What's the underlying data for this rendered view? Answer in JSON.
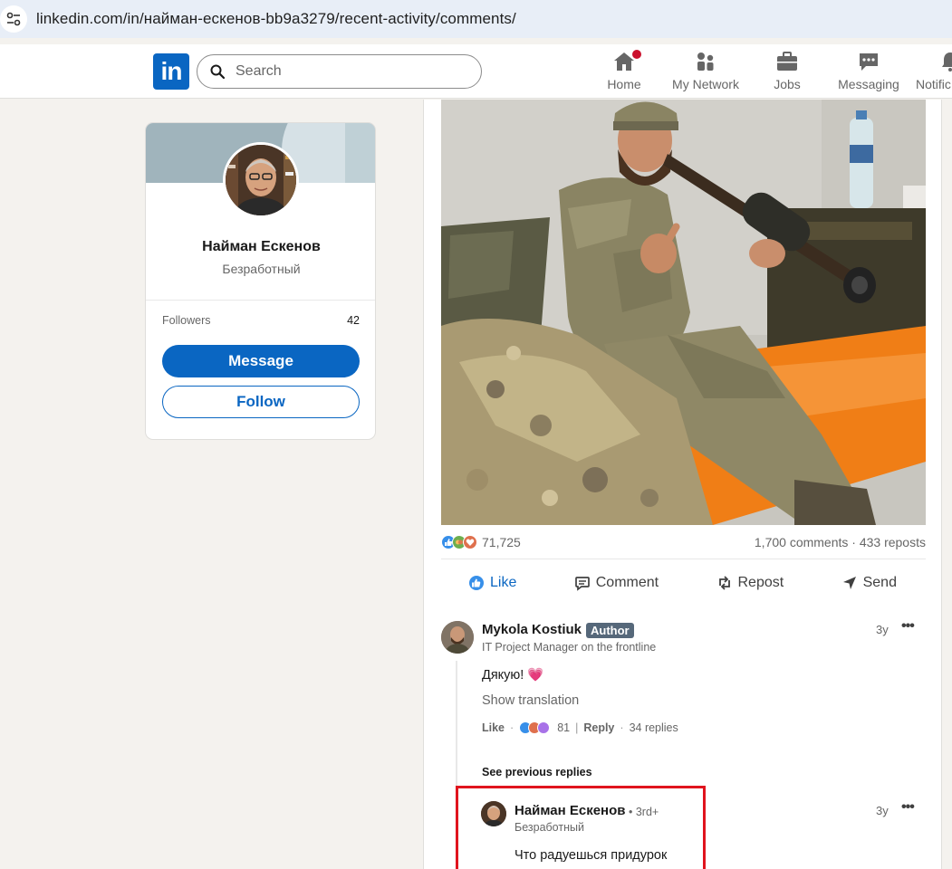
{
  "browser": {
    "url": "linkedin.com/in/найман-ескенов-bb9a3279/recent-activity/comments/"
  },
  "header": {
    "logo": "in",
    "search_placeholder": "Search",
    "nav": [
      {
        "label": "Home",
        "icon": "home-icon"
      },
      {
        "label": "My Network",
        "icon": "network-icon"
      },
      {
        "label": "Jobs",
        "icon": "briefcase-icon"
      },
      {
        "label": "Messaging",
        "icon": "chat-icon"
      },
      {
        "label": "Notific",
        "icon": "bell-icon"
      }
    ]
  },
  "profile": {
    "name": "Найман Ескенов",
    "headline": "Безработный",
    "followers_label": "Followers",
    "followers_count": "42",
    "message_label": "Message",
    "follow_label": "Follow"
  },
  "post": {
    "reactions_count": "71,725",
    "comments_reposts": "1,700 comments · 433 reposts",
    "actions": {
      "like": "Like",
      "comment": "Comment",
      "repost": "Repost",
      "send": "Send"
    }
  },
  "comment1": {
    "name": "Mykola Kostiuk",
    "badge": "Author",
    "headline": "IT Project Manager on the frontline",
    "time": "3y",
    "text": "Дякую! 💗",
    "show_translation": "Show translation",
    "like": "Like",
    "reactions": "81",
    "reply": "Reply",
    "replies": "34 replies"
  },
  "see_previous": "See previous replies",
  "comment2": {
    "name": "Найман Ескенов",
    "degree": "• 3rd+",
    "headline": "Безработный",
    "time": "3y",
    "text": "Что радуешься придурок"
  },
  "colors": {
    "brand": "#0a66c2",
    "highlight": "#e0141e",
    "notification": "#cb112d"
  }
}
